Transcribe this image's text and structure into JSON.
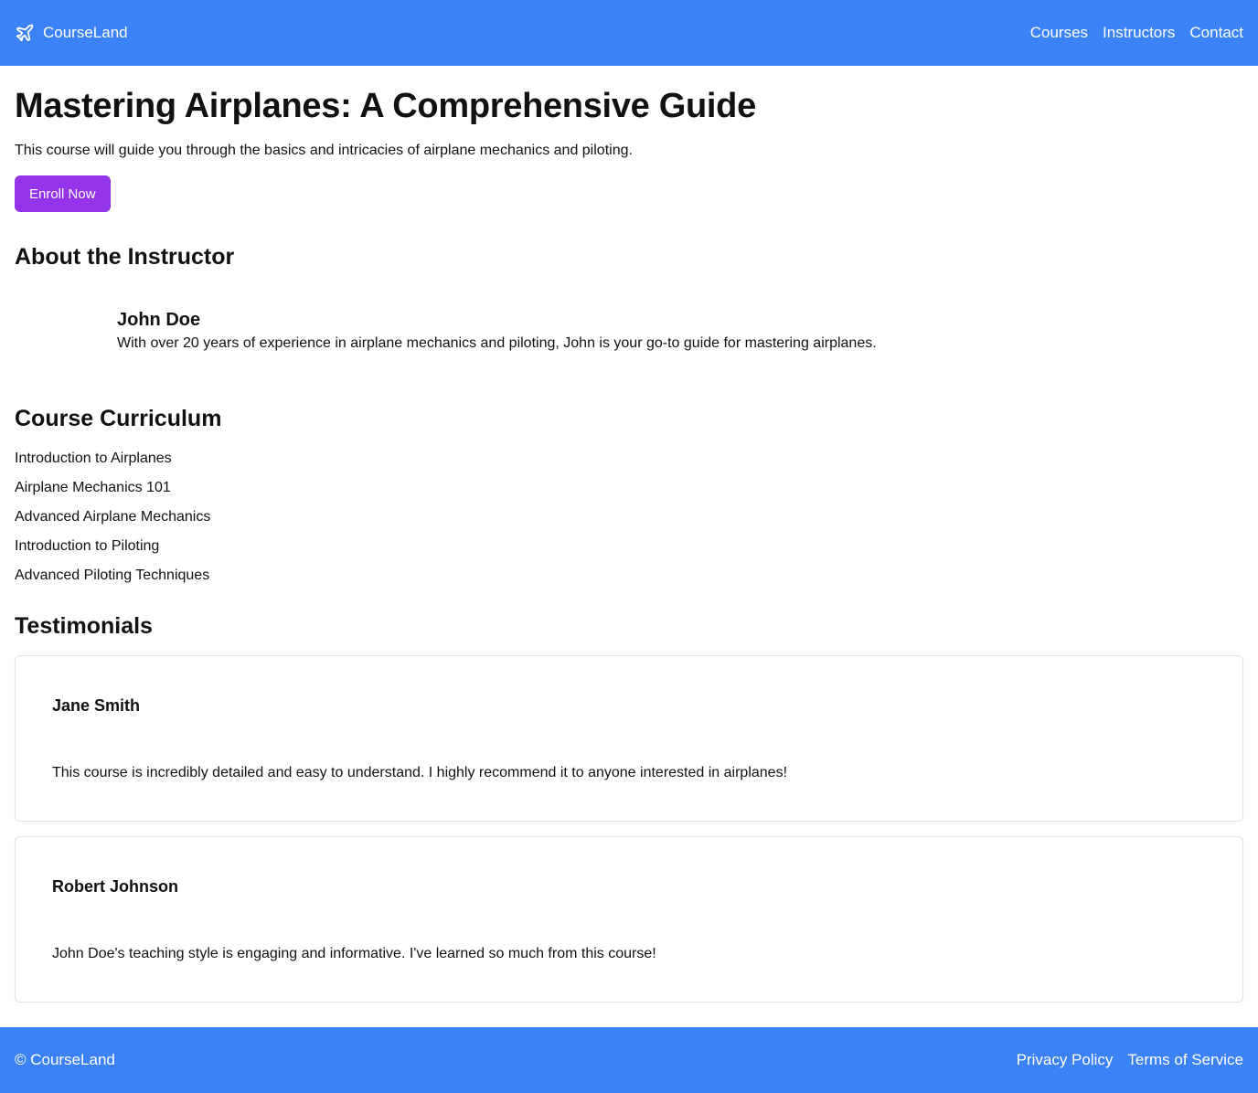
{
  "colors": {
    "brand": "#3b82f6",
    "button": "#9333ea"
  },
  "header": {
    "logo_icon": "plane-icon",
    "brand": "CourseLand",
    "nav": [
      "Courses",
      "Instructors",
      "Contact"
    ]
  },
  "course": {
    "title": "Mastering Airplanes: A Comprehensive Guide",
    "description": "This course will guide you through the basics and intricacies of airplane mechanics and piloting.",
    "enroll_label": "Enroll Now"
  },
  "instructor": {
    "heading": "About the Instructor",
    "name": "John Doe",
    "bio": "With over 20 years of experience in airplane mechanics and piloting, John is your go-to guide for mastering airplanes."
  },
  "curriculum": {
    "heading": "Course Curriculum",
    "items": [
      "Introduction to Airplanes",
      "Airplane Mechanics 101",
      "Advanced Airplane Mechanics",
      "Introduction to Piloting",
      "Advanced Piloting Techniques"
    ]
  },
  "testimonials": {
    "heading": "Testimonials",
    "items": [
      {
        "name": "Jane Smith",
        "text": "This course is incredibly detailed and easy to understand. I highly recommend it to anyone interested in airplanes!"
      },
      {
        "name": "Robert Johnson",
        "text": "John Doe's teaching style is engaging and informative. I've learned so much from this course!"
      }
    ]
  },
  "footer": {
    "copyright": "© CourseLand",
    "links": [
      "Privacy Policy",
      "Terms of Service"
    ]
  }
}
